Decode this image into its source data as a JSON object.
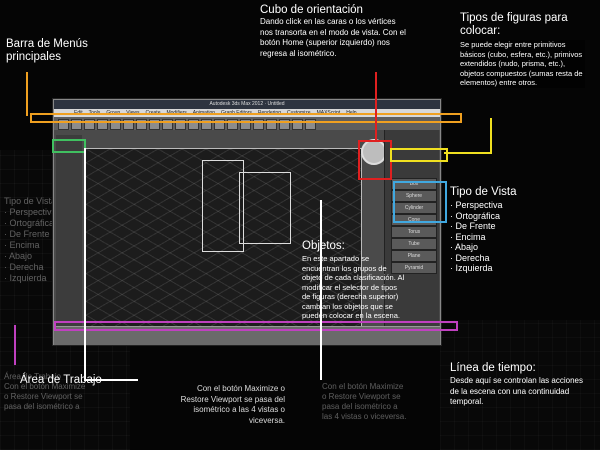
{
  "app": {
    "window_title": "Autodesk 3ds Max 2012 · Untitled",
    "menu_items": [
      "Edit",
      "Tools",
      "Group",
      "Views",
      "Create",
      "Modifiers",
      "Animation",
      "Graph Editors",
      "Rendering",
      "Customize",
      "MAXScript",
      "Help"
    ],
    "panel_rows": [
      "Box",
      "Sphere",
      "Cylinder",
      "Cone",
      "Torus",
      "Tube",
      "Plane",
      "Pyramid"
    ]
  },
  "annotations": {
    "menu_bar": {
      "title": "Barra de Menús principales"
    },
    "view_cube": {
      "title": "Cubo de orientación",
      "text": "Dando click en las caras o los vértices nos transorta en el modo de vista. Con el botón Home (superior izquierdo) nos regresa al isométrico."
    },
    "shape_types": {
      "title": "Tipos de figuras para colocar:",
      "text": "Se puede elegir entre primitivos básicos (cubo, esfera, etc.), primivos extendidos (nudo, prisma, etc.), objetos compuestos (sumas resta de elementos) entre otros."
    },
    "view_type": {
      "title": "Tipo de Vista",
      "items": [
        "Perspectiva",
        "Ortográfica",
        "De Frente",
        "Encima",
        "Abajo",
        "Derecha",
        "Izquierda"
      ]
    },
    "objects": {
      "title": "Objetos:",
      "text": "En este apartado se encuentran los grupos de objeto de cada clasificación. Al modificar el selector de tipos de figuras (derecha superior) cambian los objetos que se pueden colocar en la escena."
    },
    "work_area": {
      "title": "Área de Trabajo"
    },
    "maximize": {
      "text": "Con el botón Maximize o Restore Viewport se pasa del isométrico a las 4 vistas o viceversa."
    },
    "timeline": {
      "title": "Línea de tiempo:",
      "text": "Desde aquí se controlan las acciones de la escena con una continuidad temporal."
    }
  },
  "colors": {
    "menu_bar": "#f0a020",
    "view_cube": "#e02020",
    "shape_types": "#f0e020",
    "view_type": "#40a8e0",
    "objects": "#ffffff",
    "work_area": "#ffffff",
    "timeline": "#c040c0",
    "left_panel": "#40c060"
  },
  "ghost_text": {
    "left": "Tipo de Vista\n· Perspectiva\n· Ortográfica\n· De Frente\n· Encima\n· Abajo\n· Derecha\n· Izquierda",
    "bottom_left": "Área de Trabajo\nCon el botón Maximize\no Restore Viewport se\npasa del isométrico a",
    "bottom_mid": "Con el botón Maximize\no Restore Viewport se\npasa del isométrico a\nlas 4 vistas o viceversa."
  }
}
